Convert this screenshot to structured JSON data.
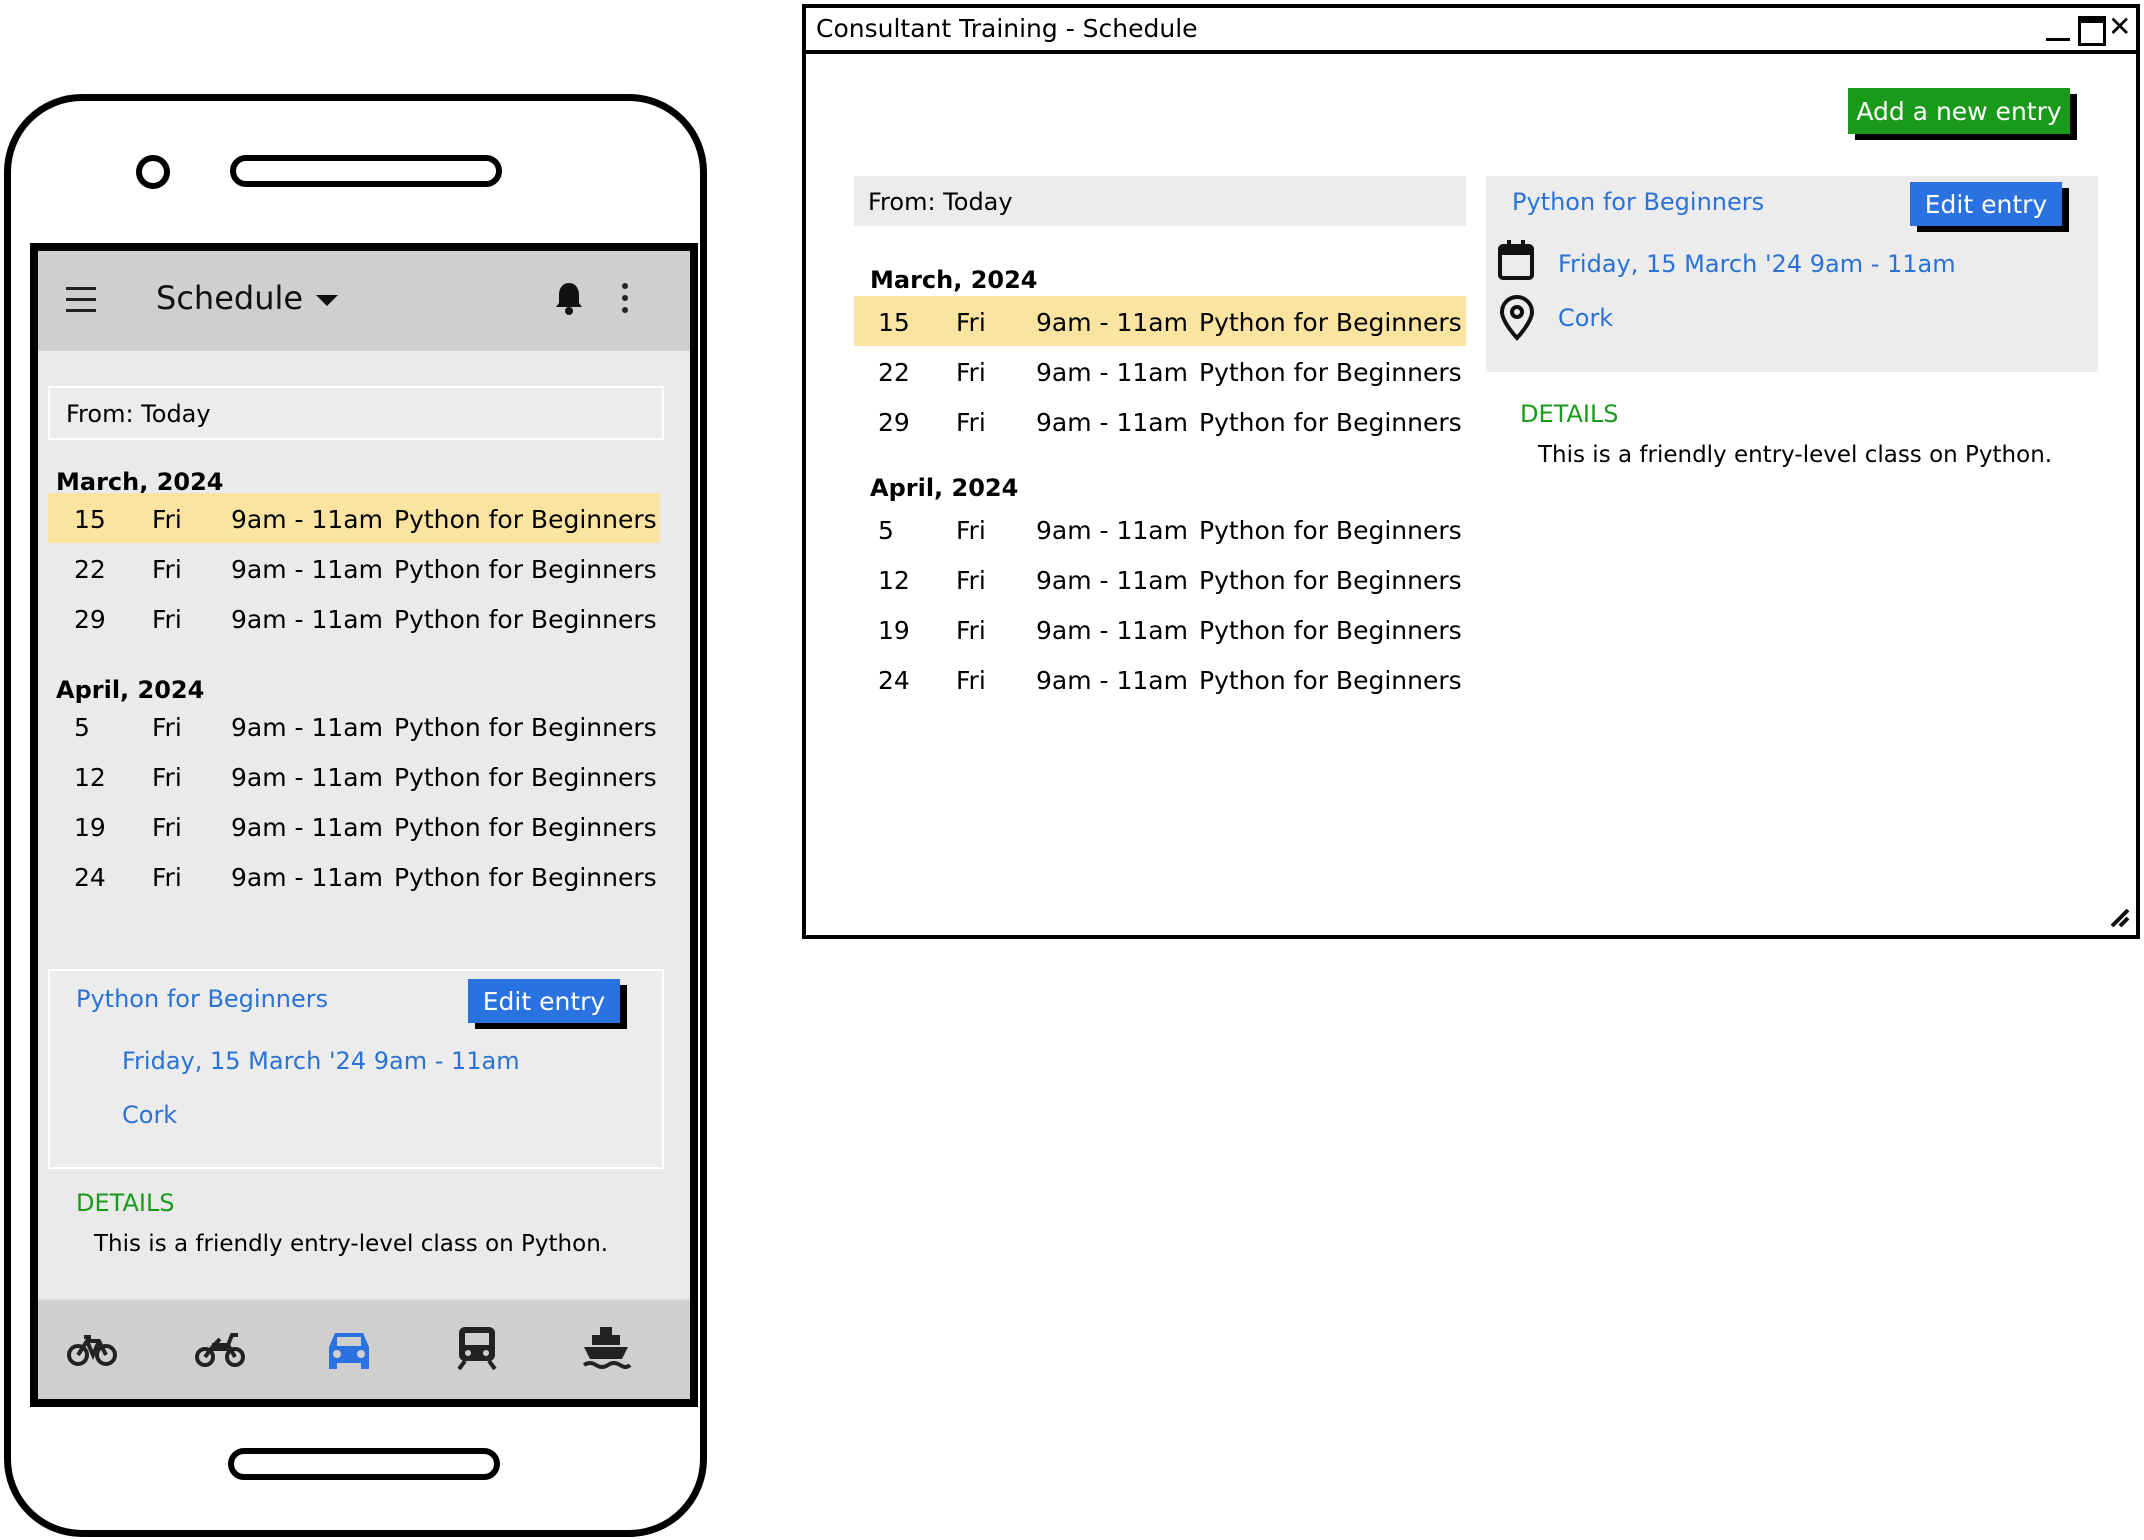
{
  "mobile": {
    "appbar": {
      "title": "Schedule"
    },
    "from_label": "From: Today",
    "months": [
      {
        "label": "March, 2024",
        "rows": [
          {
            "day": "15",
            "weekday": "Fri",
            "time": "9am - 11am",
            "course": "Python for Beginners",
            "selected": true
          },
          {
            "day": "22",
            "weekday": "Fri",
            "time": "9am - 11am",
            "course": "Python for Beginners"
          },
          {
            "day": "29",
            "weekday": "Fri",
            "time": "9am - 11am",
            "course": "Python for Beginners"
          }
        ]
      },
      {
        "label": "April, 2024",
        "rows": [
          {
            "day": "5",
            "weekday": "Fri",
            "time": "9am - 11am",
            "course": "Python for Beginners"
          },
          {
            "day": "12",
            "weekday": "Fri",
            "time": "9am - 11am",
            "course": "Python for Beginners"
          },
          {
            "day": "19",
            "weekday": "Fri",
            "time": "9am - 11am",
            "course": "Python for Beginners"
          },
          {
            "day": "24",
            "weekday": "Fri",
            "time": "9am - 11am",
            "course": "Python for Beginners"
          }
        ]
      }
    ],
    "detail": {
      "title": "Python for Beginners",
      "edit_label": "Edit entry",
      "date": "Friday, 15 March '24 9am - 11am",
      "location": "Cork",
      "details_heading": "DETAILS",
      "details_text": "This is a friendly entry-level class on Python."
    },
    "bottom_nav": [
      "bicycle-icon",
      "motorcycle-icon",
      "car-icon",
      "train-icon",
      "ship-icon"
    ],
    "active_nav": "car-icon"
  },
  "desktop": {
    "window_title": "Consultant Training - Schedule",
    "add_label": "Add a new entry",
    "from_label": "From: Today",
    "months": [
      {
        "label": "March, 2024",
        "rows": [
          {
            "day": "15",
            "weekday": "Fri",
            "time": "9am - 11am",
            "course": "Python for Beginners",
            "selected": true
          },
          {
            "day": "22",
            "weekday": "Fri",
            "time": "9am - 11am",
            "course": "Python for Beginners"
          },
          {
            "day": "29",
            "weekday": "Fri",
            "time": "9am - 11am",
            "course": "Python for Beginners"
          }
        ]
      },
      {
        "label": "April, 2024",
        "rows": [
          {
            "day": "5",
            "weekday": "Fri",
            "time": "9am - 11am",
            "course": "Python for Beginners"
          },
          {
            "day": "12",
            "weekday": "Fri",
            "time": "9am - 11am",
            "course": "Python for Beginners"
          },
          {
            "day": "19",
            "weekday": "Fri",
            "time": "9am - 11am",
            "course": "Python for Beginners"
          },
          {
            "day": "24",
            "weekday": "Fri",
            "time": "9am - 11am",
            "course": "Python for Beginners"
          }
        ]
      }
    ],
    "detail": {
      "title": "Python for Beginners",
      "edit_label": "Edit entry",
      "date": "Friday, 15 March '24 9am - 11am",
      "location": "Cork",
      "details_heading": "DETAILS",
      "details_text": "This is a friendly entry-level class on Python."
    }
  },
  "colors": {
    "highlight": "#fbe3a0",
    "link": "#2a72d6",
    "primary_button": "#2a72e0",
    "add_button": "#1a9a1a",
    "details_heading": "#1a9a1a"
  }
}
